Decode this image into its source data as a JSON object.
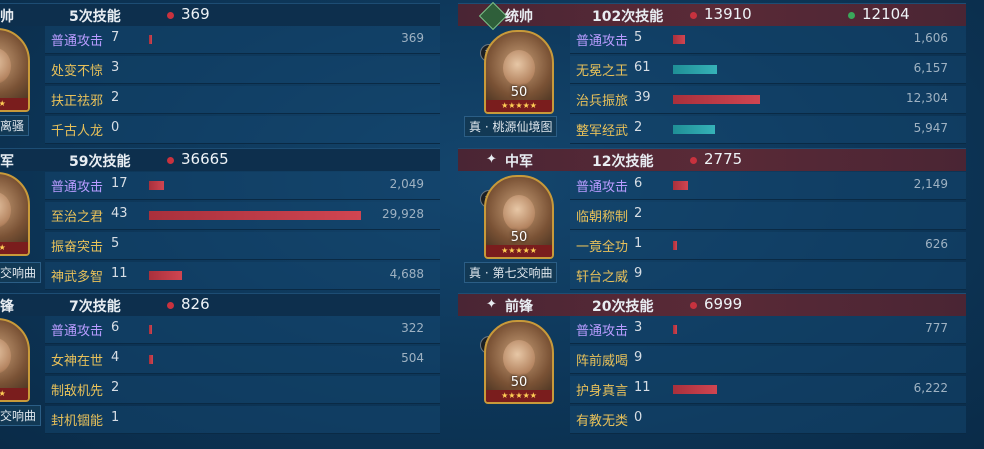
{
  "left": {
    "sections": [
      {
        "role": "帅",
        "casts": "5次技能",
        "damage": "369",
        "skills": [
          {
            "name": "普通攻击",
            "count": "7",
            "value": "369",
            "bar": 0.012
          },
          {
            "name": "处变不惊",
            "count": "3",
            "value": "",
            "bar": 0
          },
          {
            "name": "扶正祛邪",
            "count": "2",
            "value": "",
            "bar": 0
          },
          {
            "name": "千古人龙",
            "count": "0",
            "value": "",
            "bar": 0
          }
        ],
        "tactic": "离骚"
      },
      {
        "role": "军",
        "casts": "59次技能",
        "damage": "36665",
        "skills": [
          {
            "name": "普通攻击",
            "count": "17",
            "value": "2,049",
            "bar": 0.068
          },
          {
            "name": "至治之君",
            "count": "43",
            "value": "29,928",
            "bar": 1.0
          },
          {
            "name": "振奋突击",
            "count": "5",
            "value": "",
            "bar": 0
          },
          {
            "name": "神武多智",
            "count": "11",
            "value": "4,688",
            "bar": 0.157
          }
        ],
        "tactic": "交响曲"
      },
      {
        "role": "锋",
        "casts": "7次技能",
        "damage": "826",
        "skills": [
          {
            "name": "普通攻击",
            "count": "6",
            "value": "322",
            "bar": 0.011
          },
          {
            "name": "女神在世",
            "count": "4",
            "value": "504",
            "bar": 0.017
          },
          {
            "name": "制敌机先",
            "count": "2",
            "value": "",
            "bar": 0
          },
          {
            "name": "封机锢能",
            "count": "1",
            "value": "",
            "bar": 0
          }
        ],
        "tactic": "交响曲"
      }
    ]
  },
  "right": {
    "sections": [
      {
        "role": "统帅",
        "casts": "102次技能",
        "damage": "13910",
        "heal": "12104",
        "level": "50",
        "tactic": "真 · 桃源仙境图",
        "skills": [
          {
            "name": "普通攻击",
            "count": "5",
            "value": "1,606",
            "bar": 0.13,
            "color": "red"
          },
          {
            "name": "无冕之王",
            "count": "61",
            "value": "6,157",
            "bar": 0.5,
            "color": "teal"
          },
          {
            "name": "治兵振旅",
            "count": "39",
            "value": "12,304",
            "bar": 1.0,
            "color": "red"
          },
          {
            "name": "整军经武",
            "count": "2",
            "value": "5,947",
            "bar": 0.48,
            "color": "teal"
          }
        ]
      },
      {
        "role": "中军",
        "casts": "12次技能",
        "damage": "2775",
        "level": "50",
        "tactic": "真 · 第七交响曲",
        "skills": [
          {
            "name": "普通攻击",
            "count": "6",
            "value": "2,149",
            "bar": 0.17,
            "color": "red"
          },
          {
            "name": "临朝称制",
            "count": "2",
            "value": "",
            "bar": 0,
            "color": "red"
          },
          {
            "name": "一竟全功",
            "count": "1",
            "value": "626",
            "bar": 0.05,
            "color": "red"
          },
          {
            "name": "轩台之威",
            "count": "9",
            "value": "",
            "bar": 0,
            "color": "red"
          }
        ]
      },
      {
        "role": "前锋",
        "casts": "20次技能",
        "damage": "6999",
        "level": "50",
        "skills": [
          {
            "name": "普通攻击",
            "count": "3",
            "value": "777",
            "bar": 0.05,
            "color": "red"
          },
          {
            "name": "阵前威喝",
            "count": "9",
            "value": "",
            "bar": 0,
            "color": "red"
          },
          {
            "name": "护身真言",
            "count": "11",
            "value": "6,222",
            "bar": 0.5,
            "color": "red"
          },
          {
            "name": "有教无类",
            "count": "0",
            "value": "",
            "bar": 0,
            "color": "red"
          }
        ]
      }
    ]
  },
  "colors": {
    "damage_dot": "#c8323e",
    "heal_dot": "#3aa85a",
    "red_bar": "#c23c48",
    "teal_bar": "#2aa3aa"
  },
  "icons": [
    "gear-icon",
    "star-icon",
    "badge-icon"
  ]
}
